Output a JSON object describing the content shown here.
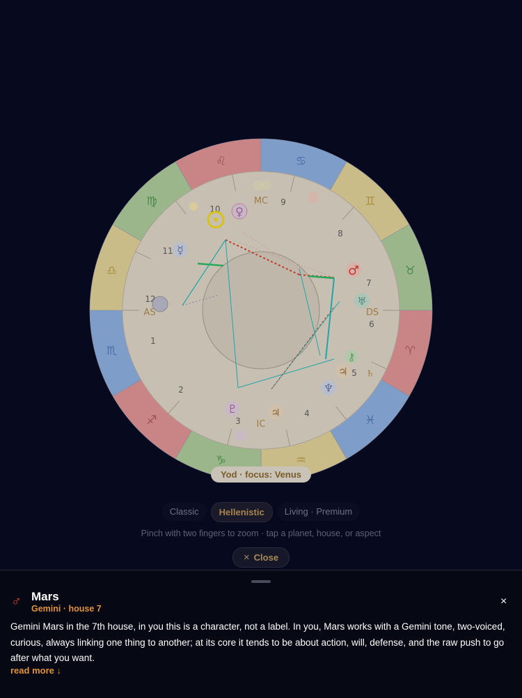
{
  "chart": {
    "focus_label": "Yod · focus: Venus",
    "angle_labels": {
      "mc": "MC",
      "as": "AS",
      "ds": "DS",
      "ic": "IC"
    },
    "house_numbers": [
      "1",
      "2",
      "3",
      "4",
      "5",
      "6",
      "7",
      "8",
      "9",
      "10",
      "11",
      "12"
    ],
    "zodiac_glyphs": [
      "♌",
      "♋",
      "♊",
      "♉",
      "♈",
      "♓",
      "♒",
      "♑",
      "♐",
      "♏",
      "♎",
      "♍"
    ],
    "planets": [
      {
        "name": "Sun",
        "glyph": "☉"
      },
      {
        "name": "Venus",
        "glyph": "♀"
      },
      {
        "name": "Mercury",
        "glyph": "☿"
      },
      {
        "name": "Mars",
        "glyph": "♂"
      },
      {
        "name": "Uranus",
        "glyph": "♅"
      },
      {
        "name": "Saturn",
        "glyph": "♄"
      },
      {
        "name": "Jupiter",
        "glyph": "♃"
      },
      {
        "name": "Neptune",
        "glyph": "♆"
      },
      {
        "name": "Chiron",
        "glyph": "⚷"
      },
      {
        "name": "Pluto",
        "glyph": "♇"
      },
      {
        "name": "Moon",
        "glyph": "☽"
      }
    ],
    "colors": {
      "fire": "#c98585",
      "earth": "#9bb68b",
      "air": "#c9bc88",
      "water": "#7e9ec9",
      "aspect_red": "#c0392b",
      "aspect_green": "#27a85a",
      "aspect_teal": "#1fa4a8"
    }
  },
  "modes": {
    "items": [
      {
        "label": "Classic",
        "active": false
      },
      {
        "label": "Hellenistic",
        "active": true
      },
      {
        "label": "Living · Premium",
        "active": false
      }
    ]
  },
  "hint": "Pinch with two fingers to zoom · tap a planet, house, or aspect",
  "close_button": {
    "icon": "×",
    "label": "Close"
  },
  "sheet": {
    "planet_glyph": "♂",
    "planet_name": "Mars",
    "subtitle": "Gemini · house 7",
    "close_icon": "×",
    "description": "Gemini Mars in the 7th house, in you this is a character, not a label. In you, Mars works with a Gemini tone, two-voiced, curious, always linking one thing to another; at its core it tends to be about action, will, defense, and the raw push to go after what you want.",
    "read_more": "read more ↓"
  }
}
